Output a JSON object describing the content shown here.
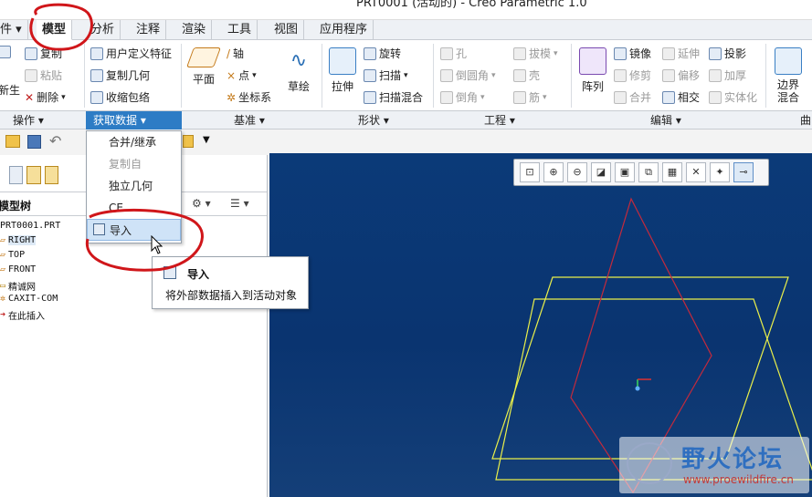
{
  "window": {
    "title": "PRT0001 (活动的) - Creo Parametric 1.0"
  },
  "tabs": [
    {
      "label": "件 ▾"
    },
    {
      "label": "模型"
    },
    {
      "label": "分析"
    },
    {
      "label": "注释"
    },
    {
      "label": "渲染"
    },
    {
      "label": "工具"
    },
    {
      "label": "视图"
    },
    {
      "label": "应用程序"
    }
  ],
  "ribbon": {
    "ops": {
      "copy": "复制",
      "paste": "粘贴",
      "delete": "删除",
      "regen": "新生"
    },
    "getdata": {
      "udf": "用户定义特征",
      "copygeom": "复制几何",
      "shrink": "收缩包络"
    },
    "datum": {
      "plane": "平面",
      "axis": "轴",
      "point": "点",
      "csys": "坐标系",
      "sketch": "草绘"
    },
    "shapes": {
      "extrude": "拉伸",
      "revolve": "旋转",
      "sweep": "扫描",
      "sweepblend": "扫描混合"
    },
    "eng": {
      "hole": "孔",
      "round": "倒圆角",
      "chamfer": "倒角",
      "draft": "拔模",
      "shell": "壳",
      "rib": "筋"
    },
    "edit": {
      "pattern": "阵列",
      "mirror": "镜像",
      "trim": "修剪",
      "merge": "合并",
      "extend": "延伸",
      "offset": "偏移",
      "intersect": "相交",
      "project": "投影",
      "thicken": "加厚",
      "solidify": "实体化"
    },
    "surf": {
      "boundary": "边界\n混合"
    }
  },
  "groups": {
    "ops": "操作 ▾",
    "getdata": "获取数据 ▾",
    "datum": "基准 ▾",
    "shapes": "形状 ▾",
    "eng": "工程 ▾",
    "edit": "编辑 ▾",
    "surf": "曲"
  },
  "dropdown": {
    "items": [
      {
        "label": "合并/继承"
      },
      {
        "label": "复制自"
      },
      {
        "label": "独立几何"
      },
      {
        "label": "CE"
      },
      {
        "label": "导入"
      }
    ]
  },
  "tooltip": {
    "title": "导入",
    "desc": "将外部数据插入到活动对象"
  },
  "modeltree": {
    "title": "模型树",
    "items": [
      {
        "label": "PRT0001.PRT"
      },
      {
        "label": "RIGHT"
      },
      {
        "label": "TOP"
      },
      {
        "label": "FRONT"
      },
      {
        "label": "精诚网"
      },
      {
        "label": "CAXIT-COM"
      },
      {
        "label": "在此插入"
      }
    ]
  },
  "watermark": {
    "title": "野火论坛",
    "url": "www.proewildfire.cn"
  },
  "colors": {
    "accent": "#2d7cc5",
    "viewport": "#0b3a78",
    "annotation": "#d0161a",
    "datum_yellow": "#e9ef4a",
    "datum_red": "#c42a3c"
  }
}
